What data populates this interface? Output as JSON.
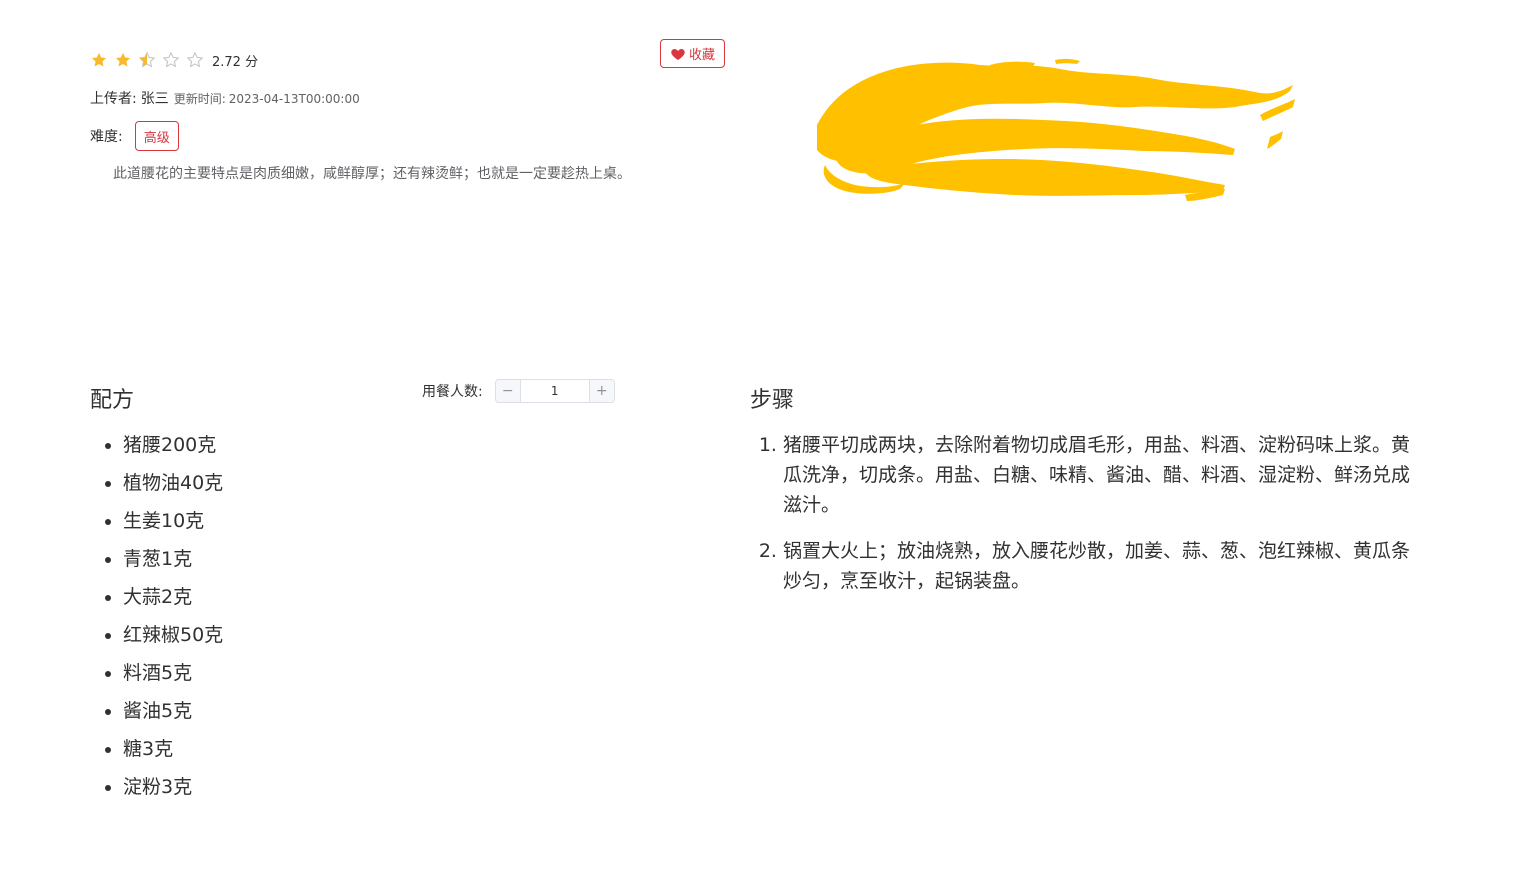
{
  "rating": {
    "value": 2.72,
    "max": 5,
    "score_text": "2.72 分",
    "stars": [
      "full",
      "full",
      "half",
      "empty",
      "empty"
    ],
    "color_active": "#f7ba2a",
    "color_empty": "#c0c4cc"
  },
  "favorite": {
    "label": "收藏",
    "icon": "heart-icon",
    "color": "#d9363e"
  },
  "meta": {
    "uploader_label": "上传者:",
    "uploader_name": "张三",
    "update_label": "更新时间:",
    "update_time": "2023-04-13T00:00:00",
    "difficulty_label": "难度:",
    "difficulty_value": "高级"
  },
  "description": "此道腰花的主要特点是肉质细嫩，咸鲜醇厚；还有辣烫鲜；也就是一定要趁热上桌。",
  "image": {
    "icon": "dish-image",
    "color": "#ffc000"
  },
  "recipe": {
    "title": "配方",
    "servings_label": "用餐人数:",
    "servings_value": "1",
    "minus_label": "−",
    "plus_label": "+",
    "ingredients": [
      "猪腰200克",
      "植物油40克",
      "生姜10克",
      "青葱1克",
      "大蒜2克",
      "红辣椒50克",
      "料酒5克",
      "酱油5克",
      "糖3克",
      "淀粉3克"
    ]
  },
  "steps": {
    "title": "步骤",
    "items": [
      "猪腰平切成两块，去除附着物切成眉毛形，用盐、料酒、淀粉码味上浆。黄瓜洗净，切成条。用盐、白糖、味精、酱油、醋、料酒、湿淀粉、鲜汤兑成滋汁。",
      "锅置大火上；放油烧熟，放入腰花炒散，加姜、蒜、葱、泡红辣椒、黄瓜条炒匀，烹至收汁，起锅装盘。"
    ]
  }
}
